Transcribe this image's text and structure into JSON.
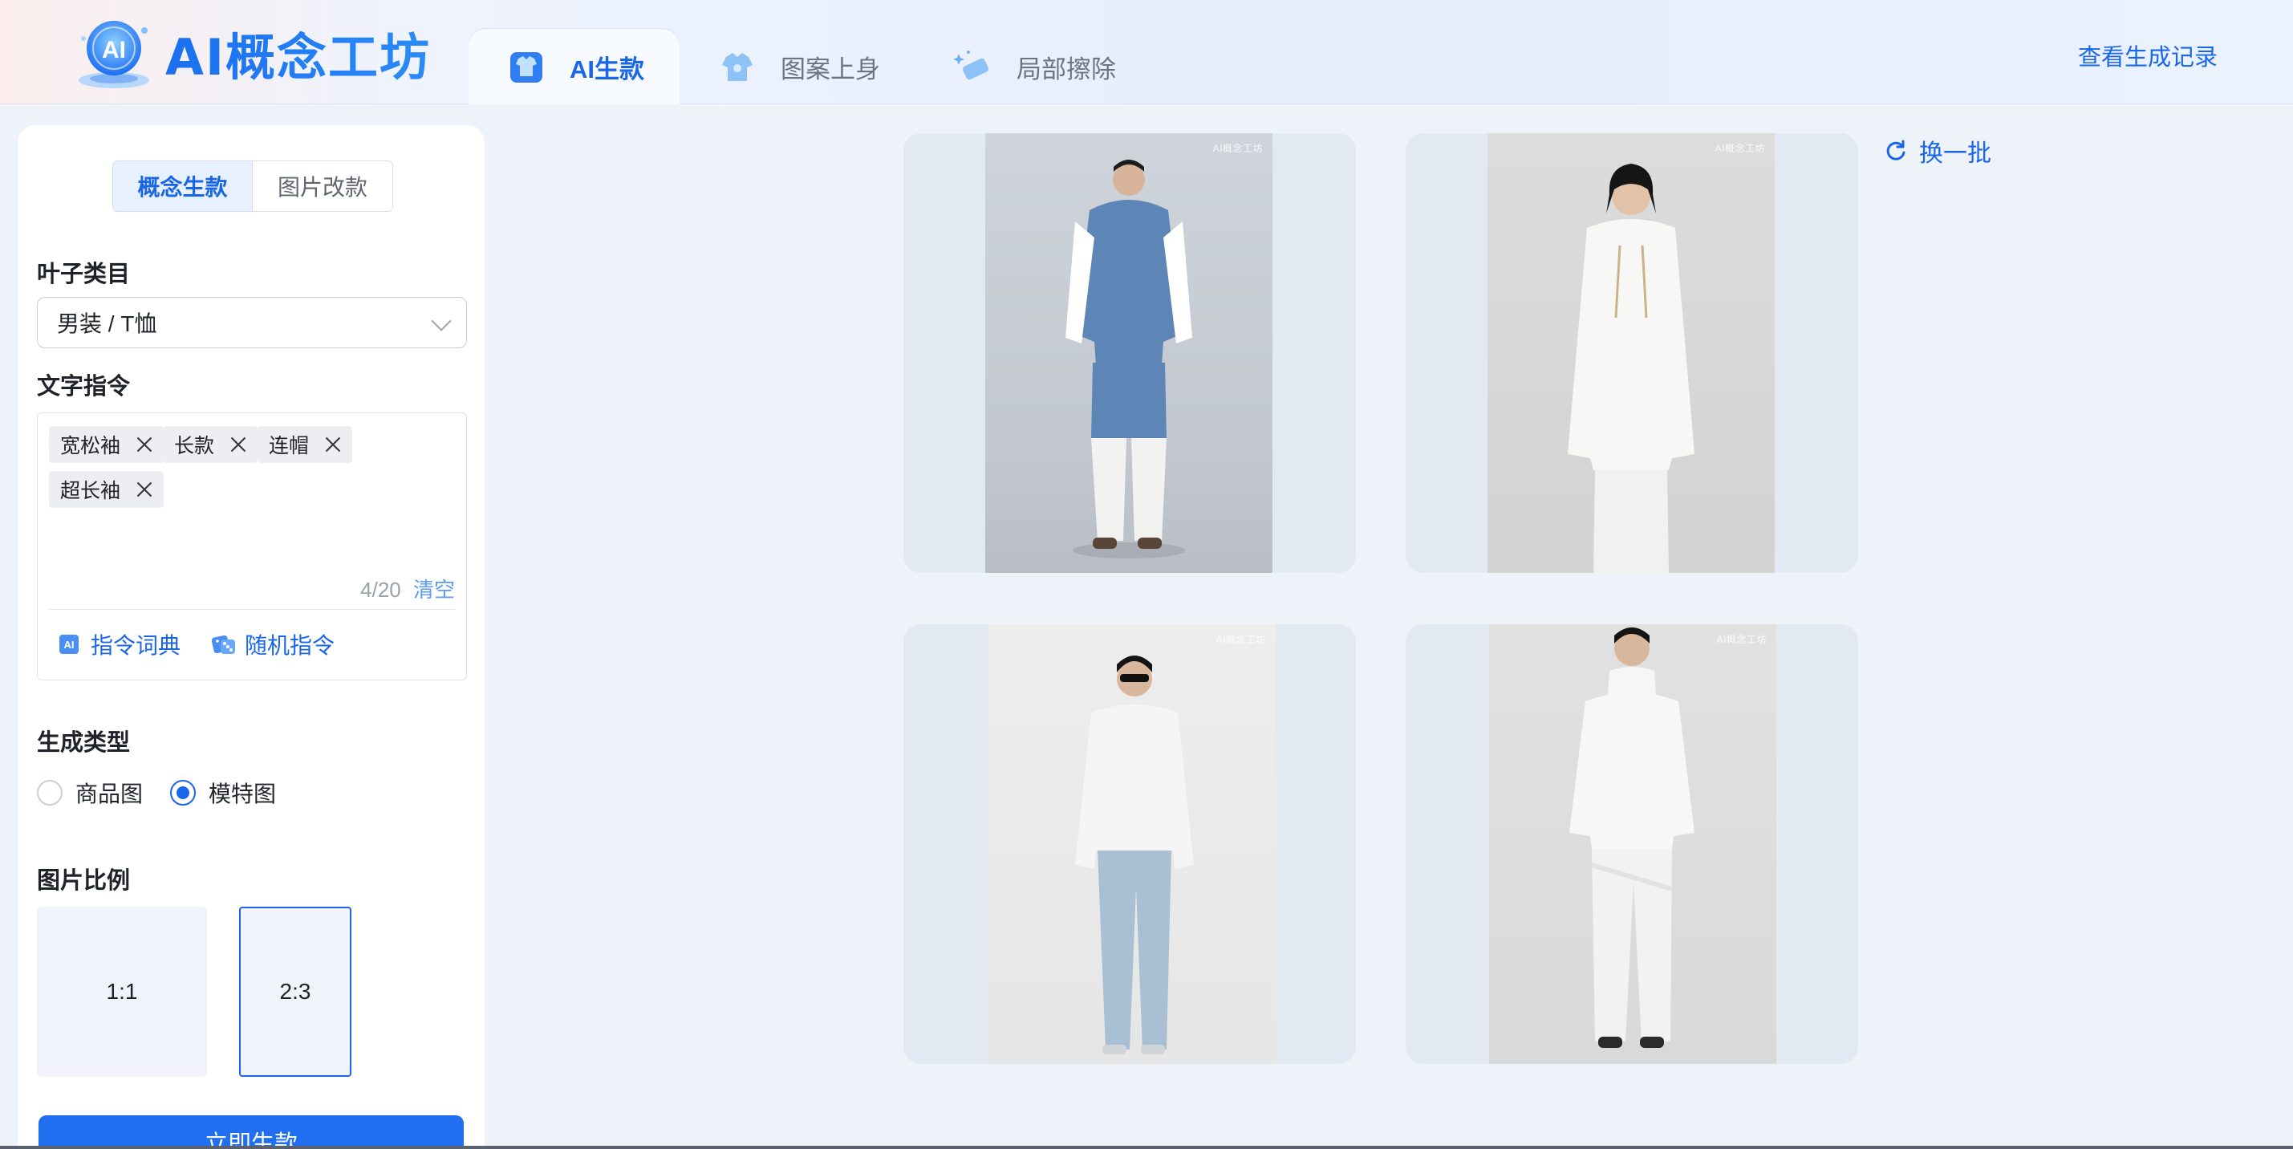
{
  "app": {
    "logo_text": "AI概念工坊",
    "logo_badge": "AI"
  },
  "nav": {
    "tabs": [
      {
        "label": "AI生款",
        "icon": "tshirt-icon",
        "active": true
      },
      {
        "label": "图案上身",
        "icon": "shirt-print-icon",
        "active": false
      },
      {
        "label": "局部擦除",
        "icon": "eraser-icon",
        "active": false
      }
    ],
    "history_link": "查看生成记录"
  },
  "panel": {
    "mode_tabs": [
      {
        "label": "概念生款",
        "active": true
      },
      {
        "label": "图片改款",
        "active": false
      }
    ],
    "category_label": "叶子类目",
    "category_value": "男装 / T恤",
    "prompt_label": "文字指令",
    "tags": [
      "宽松袖",
      "长款",
      "连帽",
      "超长袖"
    ],
    "counter": "4/20",
    "clear_label": "清空",
    "dict_label": "指令词典",
    "random_label": "随机指令",
    "type_label": "生成类型",
    "types": [
      {
        "label": "商品图",
        "selected": false
      },
      {
        "label": "模特图",
        "selected": true
      }
    ],
    "ratio_label": "图片比例",
    "ratios": [
      {
        "label": "1:1",
        "selected": false
      },
      {
        "label": "2:3",
        "selected": true
      }
    ],
    "generate_label": "立即生款"
  },
  "results": {
    "refresh_label": "换一批",
    "watermark": "AI概念工坊",
    "images": [
      {
        "name": "generated-model-1",
        "outfit": "blue-hoodie-white-pants"
      },
      {
        "name": "generated-model-2",
        "outfit": "white-hoodie-white-pants"
      },
      {
        "name": "generated-model-3",
        "outfit": "white-hoodie-jeans-sunglasses"
      },
      {
        "name": "generated-model-4",
        "outfit": "white-layered-hoodie"
      }
    ]
  },
  "colors": {
    "accent": "#1a66e8",
    "button": "#1f6ff0",
    "background": "#eef3fa"
  }
}
